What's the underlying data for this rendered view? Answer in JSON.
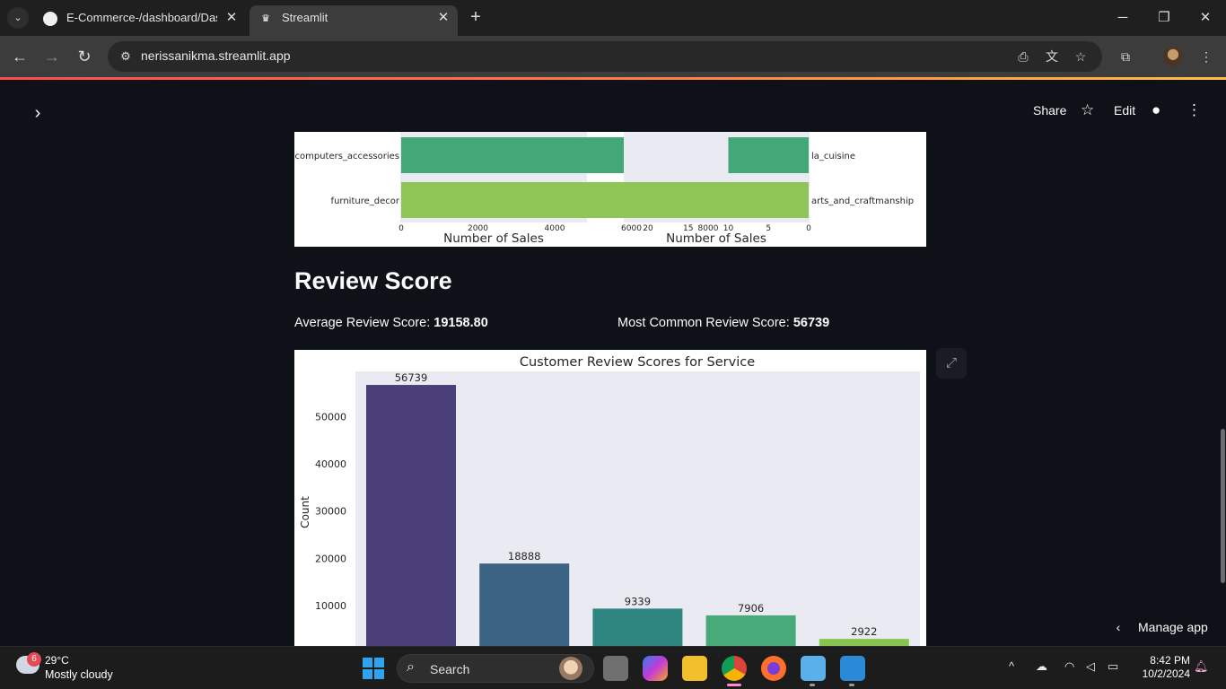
{
  "browser": {
    "tabs": [
      {
        "title": "E-Commerce-/dashboard/Dasb",
        "icon": "github-icon",
        "active": false
      },
      {
        "title": "Streamlit",
        "icon": "streamlit-icon",
        "active": true
      }
    ],
    "url": "nerissanikma.streamlit.app"
  },
  "app_header": {
    "share_label": "Share",
    "edit_label": "Edit"
  },
  "review": {
    "heading": "Review Score",
    "avg_label": "Average Review Score:",
    "avg_value": "19158.80",
    "common_label": "Most Common Review Score:",
    "common_value": "56739"
  },
  "manage_app_label": "Manage app",
  "chart_data": [
    {
      "type": "bar",
      "orientation": "horizontal",
      "categories": [
        "computers_accessories",
        "furniture_decor"
      ],
      "values": [
        6400,
        6100
      ],
      "xlabel": "Number of Sales",
      "xticks": [
        "0",
        "2000",
        "4000",
        "6000",
        "8000"
      ],
      "xlim": [
        0,
        9500
      ],
      "colors": [
        "#43a877",
        "#8fc556"
      ],
      "grid": false
    },
    {
      "type": "bar",
      "orientation": "horizontal",
      "inverted_x": true,
      "categories": [
        "la_cuisine",
        "arts_and_craftmanship"
      ],
      "values": [
        10,
        24
      ],
      "xlabel": "Number of Sales",
      "xticks": [
        "20",
        "15",
        "10",
        "5",
        "0"
      ],
      "xlim": [
        0,
        25
      ],
      "colors": [
        "#43a877",
        "#8fc556"
      ],
      "grid": false
    },
    {
      "type": "bar",
      "title": "Customer Review Scores for Service",
      "ylabel": "Count",
      "values": [
        56739,
        18888,
        9339,
        7906,
        2922
      ],
      "yticks": [
        "10000",
        "20000",
        "30000",
        "40000",
        "50000"
      ],
      "colors": [
        "#4a3f79",
        "#3b6383",
        "#2f8680",
        "#47aa78",
        "#8ac450"
      ],
      "grid": false
    }
  ],
  "taskbar": {
    "temperature": "29°C",
    "weather": "Mostly cloudy",
    "weather_badge": "6",
    "search_label": "Search",
    "time": "8:42 PM",
    "date": "10/2/2024"
  }
}
